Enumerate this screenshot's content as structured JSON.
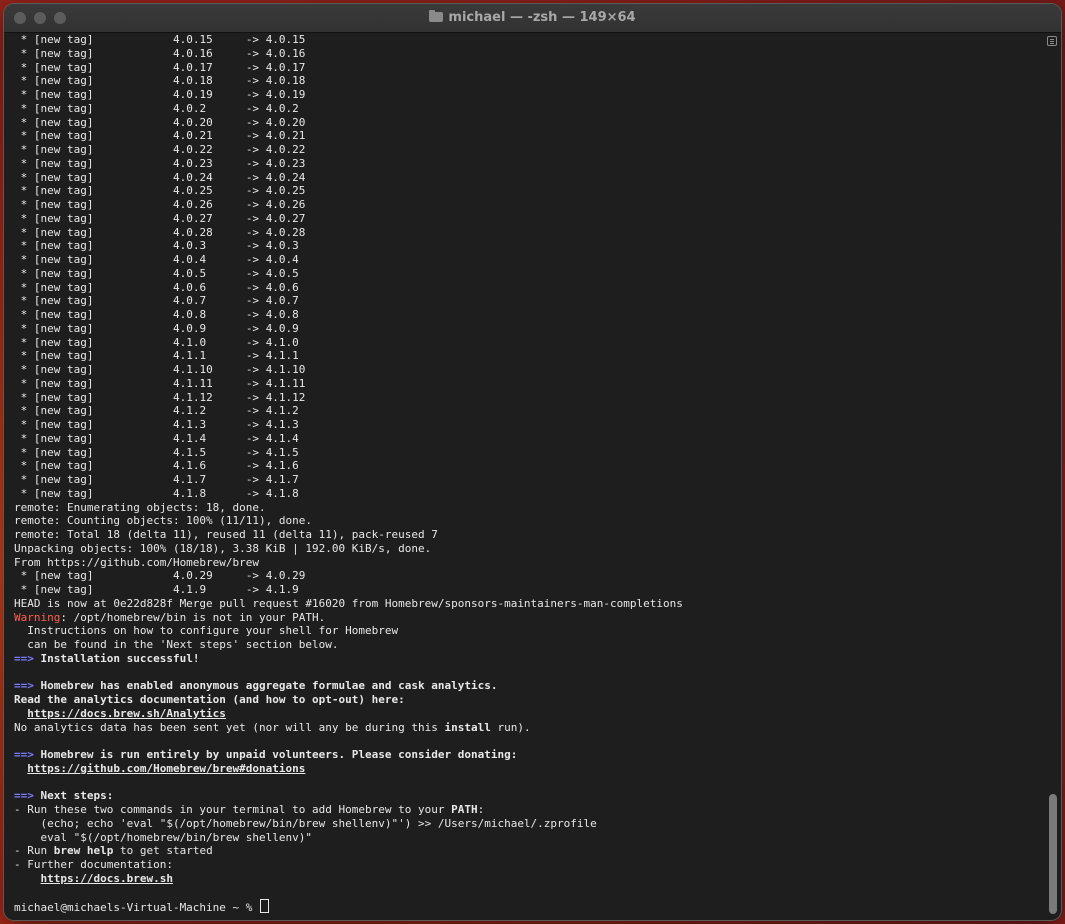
{
  "window": {
    "title": "michael — -zsh — 149×64"
  },
  "tag_lines": [
    {
      "from": "4.0.15",
      "to": "4.0.15"
    },
    {
      "from": "4.0.16",
      "to": "4.0.16"
    },
    {
      "from": "4.0.17",
      "to": "4.0.17"
    },
    {
      "from": "4.0.18",
      "to": "4.0.18"
    },
    {
      "from": "4.0.19",
      "to": "4.0.19"
    },
    {
      "from": "4.0.2",
      "to": "4.0.2"
    },
    {
      "from": "4.0.20",
      "to": "4.0.20"
    },
    {
      "from": "4.0.21",
      "to": "4.0.21"
    },
    {
      "from": "4.0.22",
      "to": "4.0.22"
    },
    {
      "from": "4.0.23",
      "to": "4.0.23"
    },
    {
      "from": "4.0.24",
      "to": "4.0.24"
    },
    {
      "from": "4.0.25",
      "to": "4.0.25"
    },
    {
      "from": "4.0.26",
      "to": "4.0.26"
    },
    {
      "from": "4.0.27",
      "to": "4.0.27"
    },
    {
      "from": "4.0.28",
      "to": "4.0.28"
    },
    {
      "from": "4.0.3",
      "to": "4.0.3"
    },
    {
      "from": "4.0.4",
      "to": "4.0.4"
    },
    {
      "from": "4.0.5",
      "to": "4.0.5"
    },
    {
      "from": "4.0.6",
      "to": "4.0.6"
    },
    {
      "from": "4.0.7",
      "to": "4.0.7"
    },
    {
      "from": "4.0.8",
      "to": "4.0.8"
    },
    {
      "from": "4.0.9",
      "to": "4.0.9"
    },
    {
      "from": "4.1.0",
      "to": "4.1.0"
    },
    {
      "from": "4.1.1",
      "to": "4.1.1"
    },
    {
      "from": "4.1.10",
      "to": "4.1.10"
    },
    {
      "from": "4.1.11",
      "to": "4.1.11"
    },
    {
      "from": "4.1.12",
      "to": "4.1.12"
    },
    {
      "from": "4.1.2",
      "to": "4.1.2"
    },
    {
      "from": "4.1.3",
      "to": "4.1.3"
    },
    {
      "from": "4.1.4",
      "to": "4.1.4"
    },
    {
      "from": "4.1.5",
      "to": "4.1.5"
    },
    {
      "from": "4.1.6",
      "to": "4.1.6"
    },
    {
      "from": "4.1.7",
      "to": "4.1.7"
    },
    {
      "from": "4.1.8",
      "to": "4.1.8"
    }
  ],
  "tag_prefix": " * [new tag]",
  "arrow": "->",
  "remote_lines": [
    "remote: Enumerating objects: 18, done.",
    "remote: Counting objects: 100% (11/11), done.",
    "remote: Total 18 (delta 11), reused 11 (delta 11), pack-reused 7",
    "Unpacking objects: 100% (18/18), 3.38 KiB | 192.00 KiB/s, done.",
    "From https://github.com/Homebrew/brew"
  ],
  "tag_lines_2": [
    {
      "from": "4.0.29",
      "to": "4.0.29"
    },
    {
      "from": "4.1.9",
      "to": "4.1.9"
    }
  ],
  "head_line": "HEAD is now at 0e22d828f Merge pull request #16020 from Homebrew/sponsors-maintainers-man-completions",
  "warning": {
    "label": "Warning",
    "text": ": /opt/homebrew/bin is not in your PATH.",
    "line2": "  Instructions on how to configure your shell for Homebrew",
    "line3": "  can be found in the 'Next steps' section below."
  },
  "marker": "==>",
  "install_success": "Installation successful!",
  "analytics": {
    "heading": "Homebrew has enabled anonymous aggregate formulae and cask analytics.",
    "read": "Read the analytics documentation (and how to opt-out) here:",
    "link": "https://docs.brew.sh/Analytics",
    "note_pre": "No analytics data has been sent yet (nor will any be during this ",
    "note_bold": "install",
    "note_post": " run)."
  },
  "donate": {
    "heading": "Homebrew is run entirely by unpaid volunteers. Please consider donating:",
    "link": "https://github.com/Homebrew/brew#donations"
  },
  "next_steps": {
    "heading": "Next steps:",
    "run_pre": "- Run these two commands in your terminal to add Homebrew to your ",
    "run_bold": "PATH",
    "run_post": ":",
    "cmd1": "    (echo; echo 'eval \"$(/opt/homebrew/bin/brew shellenv)\"') >> /Users/michael/.zprofile",
    "cmd2": "    eval \"$(/opt/homebrew/bin/brew shellenv)\"",
    "help_pre": "- Run ",
    "help_bold": "brew help",
    "help_post": " to get started",
    "further": "- Further documentation:",
    "docs_link": "https://docs.brew.sh"
  },
  "prompt": "michael@michaels-Virtual-Machine ~ % "
}
